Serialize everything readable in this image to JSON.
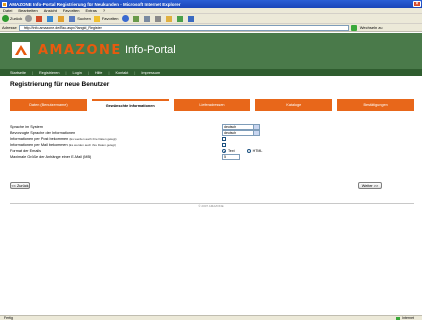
{
  "window": {
    "title": "AMAZONE Info-Portal Registrierung für Neukunden - Microsoft Internet Explorer"
  },
  "menu": [
    "Datei",
    "Bearbeiten",
    "Ansicht",
    "Favoriten",
    "Extras",
    "?"
  ],
  "toolbar": {
    "back": "Zurück",
    "search": "Suchen",
    "favorites": "Favoriten"
  },
  "address": {
    "label": "Adresse",
    "url": "http://info.amazone.de/Bsc.aspx?langid_Register",
    "links": "Wechseln zu"
  },
  "banner": {
    "brand": "AMAZONE",
    "portal": "Info-Portal"
  },
  "sitenav": [
    "Startseite",
    "Registrieren",
    "Login",
    "Hilfe",
    "Kontakt",
    "Impressum"
  ],
  "page": {
    "title": "Registrierung für neue Benutzer"
  },
  "steps": [
    {
      "label": "Daten (Benutzername)"
    },
    {
      "label": "Gewünschte Informationen"
    },
    {
      "label": "Lieferadressen"
    },
    {
      "label": "Kataloge"
    },
    {
      "label": "Bestätigungen"
    }
  ],
  "form": {
    "system_language": {
      "label": "Sprache im System",
      "value": "deutsch"
    },
    "info_language": {
      "label": "Bevorzugte Sprache der Informationen",
      "value": "deutsch"
    },
    "info_post": {
      "label": "Informationen per Post bekommen",
      "note": "(Es werden auch ihre Daten gelegt)"
    },
    "info_email": {
      "label": "Informationen per Mail bekommen",
      "note": "(Es werden auch ihre Daten gelegt)"
    },
    "email_format": {
      "label": "Format der Emails",
      "options": [
        "Text",
        "HTML"
      ],
      "selected": "Text"
    },
    "max_size": {
      "label": "Maximale Größe der Anhänge einer E-Mail (MB)",
      "value": "5"
    }
  },
  "buttons": {
    "back": "<< Zurück",
    "next": "Weiter >>"
  },
  "footer": {
    "copyright": "© 2007 AMAZONE"
  },
  "status": {
    "text": "Fertig",
    "zone": "Internet"
  }
}
